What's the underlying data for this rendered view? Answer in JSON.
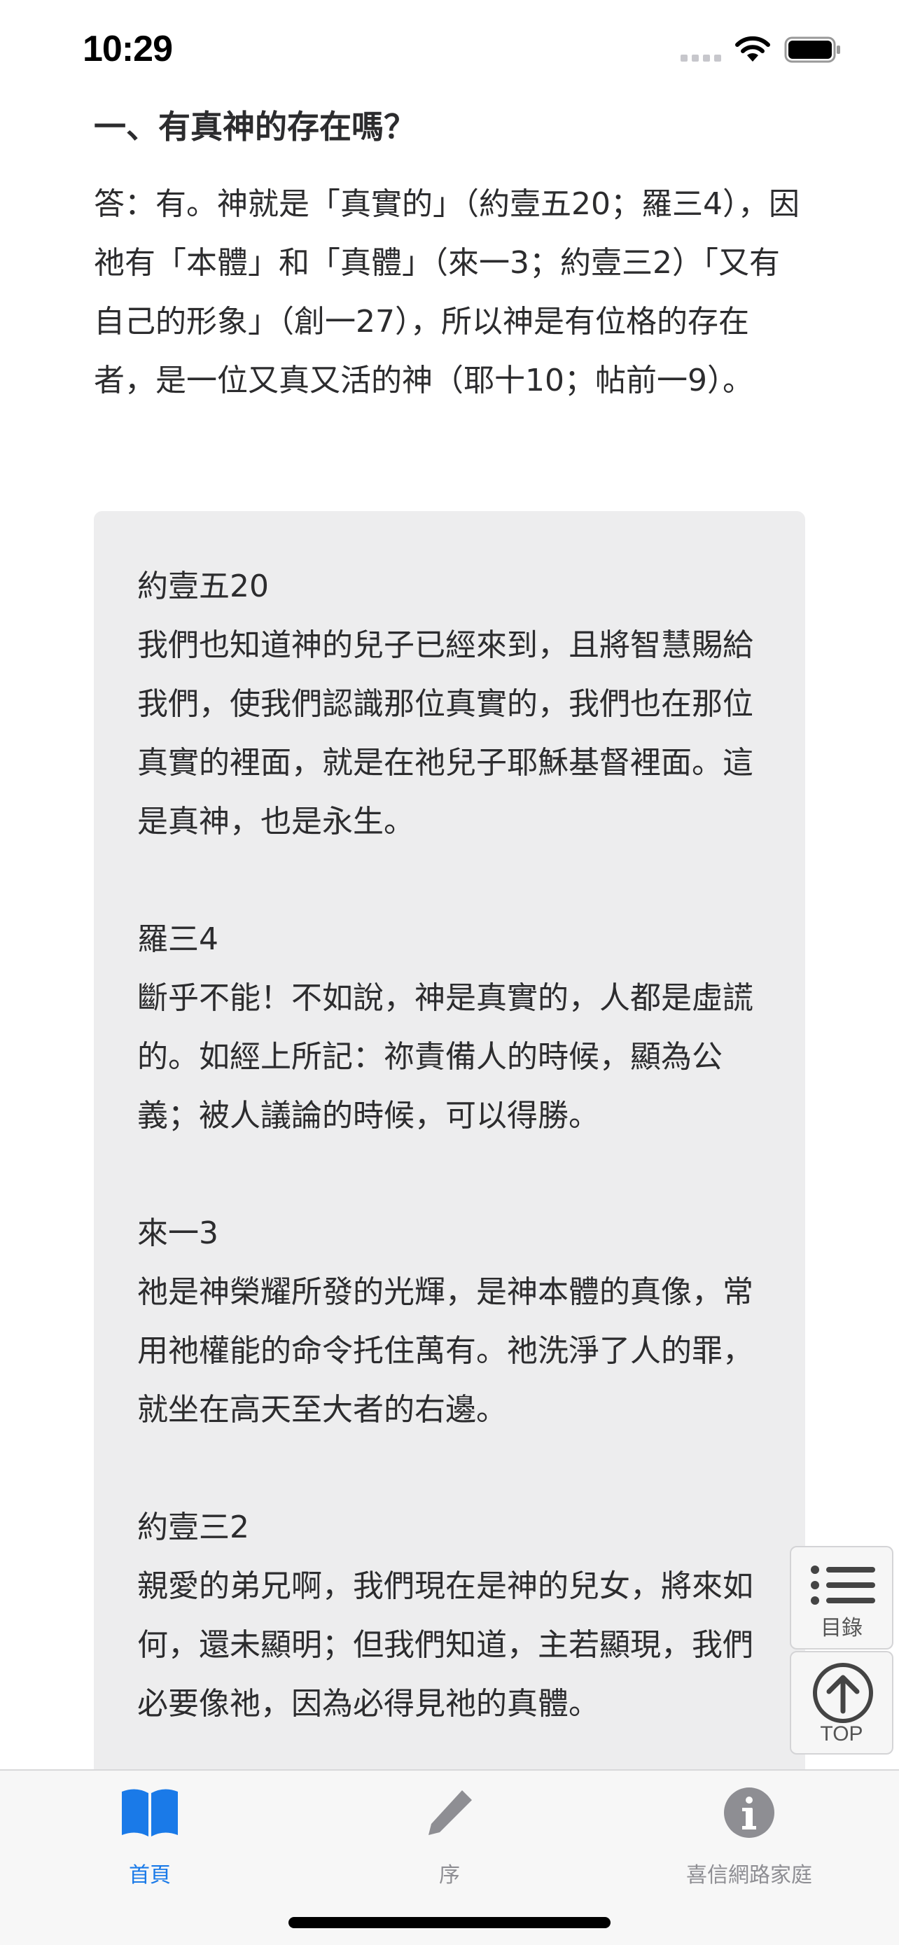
{
  "status_bar": {
    "time": "10:29"
  },
  "content": {
    "question": "一、有真神的存在嗎？",
    "answer": "答：有。神就是「真實的」（約壹五20；羅三4），因祂有「本體」和「真體」（來一3；約壹三2）「又有自己的形象」（創一27），所以神是有位格的存在者，是一位又真又活的神（耶十10；帖前一9）。",
    "verses": [
      {
        "ref": "約壹五20",
        "text": "我們也知道神的兒子已經來到，且將智慧賜給我們，使我們認識那位真實的，我們也在那位真實的裡面，就是在祂兒子耶穌基督裡面。這是真神，也是永生。"
      },
      {
        "ref": "羅三4",
        "text": "斷乎不能！不如說，神是真實的，人都是虛謊的。如經上所記：祢責備人的時候，顯為公義；被人議論的時候，可以得勝。"
      },
      {
        "ref": "來一3",
        "text": "祂是神榮耀所發的光輝，是神本體的真像，常用祂權能的命令托住萬有。祂洗淨了人的罪，就坐在高天至大者的右邊。"
      },
      {
        "ref": "約壹三2",
        "text": "親愛的弟兄啊，我們現在是神的兒女，將來如何，還未顯明；但我們知道，主若顯現，我們必要像祂，因為必得見祂的真體。"
      }
    ]
  },
  "floating_buttons": {
    "toc_label": "目錄",
    "top_label": "TOP"
  },
  "tab_bar": {
    "tabs": [
      {
        "label": "首頁",
        "icon": "book-icon",
        "active": true
      },
      {
        "label": "序",
        "icon": "pencil-icon",
        "active": false
      },
      {
        "label": "喜信網路家庭",
        "icon": "info-icon",
        "active": false
      }
    ],
    "active_color": "#1a7ae8",
    "inactive_color": "#8e8e93"
  }
}
